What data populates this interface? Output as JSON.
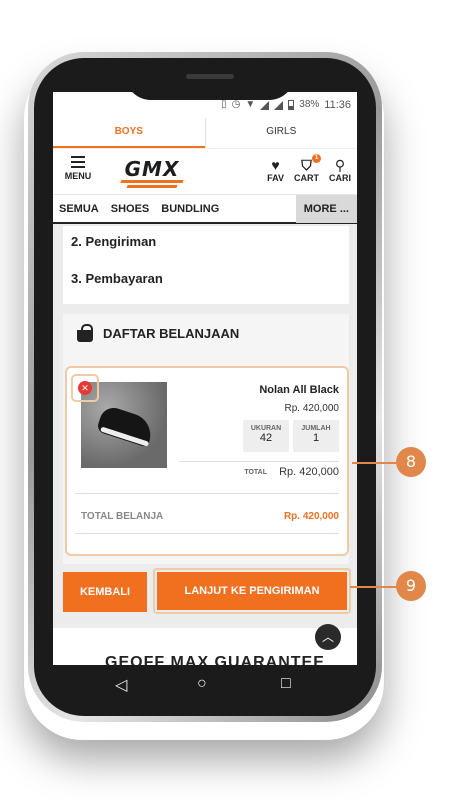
{
  "status_bar": {
    "battery": "38%",
    "time": "11:36"
  },
  "tabs": [
    {
      "label": "BOYS",
      "active": true
    },
    {
      "label": "GIRLS",
      "active": false
    }
  ],
  "header": {
    "menu_label": "MENU",
    "logo": "GMX",
    "fav_label": "FAV",
    "cart_label": "CART",
    "cart_count": "1",
    "search_label": "CARI"
  },
  "categories": {
    "items": [
      "SEMUA",
      "SHOES",
      "BUNDLING"
    ],
    "more": "MORE ..."
  },
  "steps": {
    "step2": "2. Pengiriman",
    "step3": "3. Pembayaran"
  },
  "cart": {
    "title": "DAFTAR BELANJAAN",
    "item": {
      "name": "Nolan All Black",
      "price": "Rp. 420,000",
      "size_label": "UKURAN",
      "size": "42",
      "qty_label": "JUMLAH",
      "qty": "1",
      "total_label": "TOTAL",
      "total": "Rp. 420,000"
    },
    "grand_total_label": "TOTAL BELANJA",
    "grand_total": "Rp. 420,000"
  },
  "buttons": {
    "back": "KEMBALI",
    "next": "LANJUT KE PENGIRIMAN"
  },
  "footer": {
    "guarantee": "GEOFF MAX GUARANTEE"
  },
  "callouts": {
    "c8": "8",
    "c9": "9"
  },
  "colors": {
    "accent": "#f07020",
    "callout": "#e2874a",
    "remove": "#e53935"
  },
  "icons": {
    "status": [
      "vibrate-icon",
      "alarm-icon",
      "wifi-icon",
      "signal-icon",
      "battery-icon"
    ],
    "nav": [
      "back-icon",
      "home-icon",
      "recents-icon"
    ]
  }
}
